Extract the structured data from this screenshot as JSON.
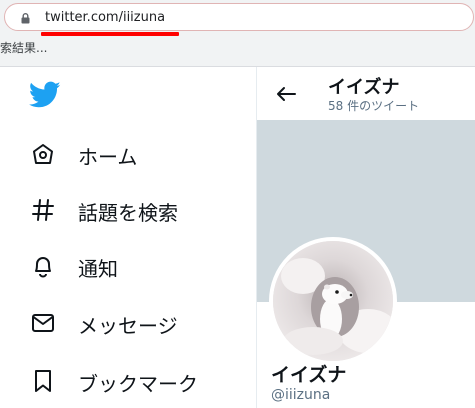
{
  "browser": {
    "url": "twitter.com/iiizuna",
    "bookmark_text": "索結果..."
  },
  "nav": {
    "items": [
      {
        "label": "ホーム",
        "icon": "home-icon"
      },
      {
        "label": "話題を検索",
        "icon": "hashtag-icon"
      },
      {
        "label": "通知",
        "icon": "bell-icon"
      },
      {
        "label": "メッセージ",
        "icon": "envelope-icon"
      },
      {
        "label": "ブックマーク",
        "icon": "bookmark-icon"
      }
    ]
  },
  "profile": {
    "header_name": "イイズナ",
    "tweet_count": "58 件のツイート",
    "display_name": "イイズナ",
    "handle": "@iiizuna"
  },
  "colors": {
    "twitter_blue": "#1da1f2",
    "banner": "#cfd9de",
    "url_underline": "#ff0000"
  }
}
